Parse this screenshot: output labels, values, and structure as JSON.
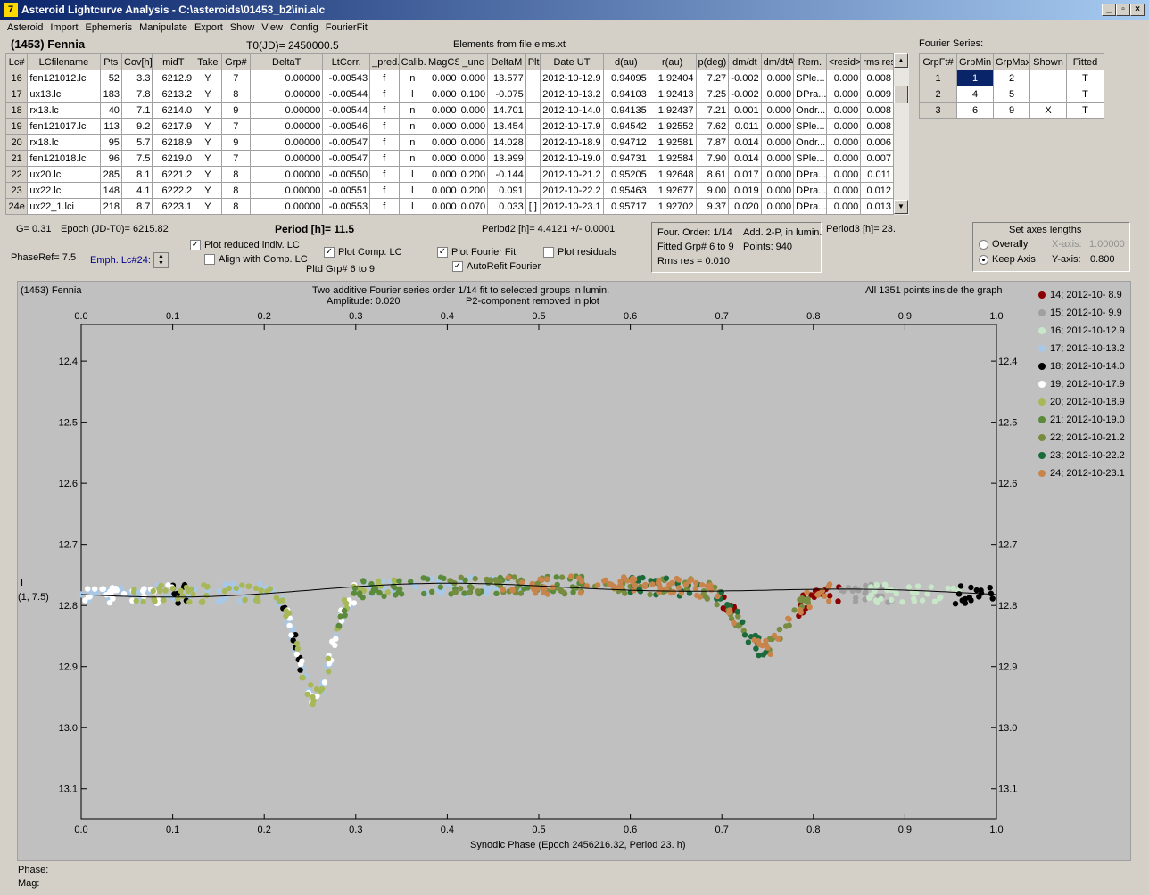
{
  "window": {
    "title": "Asteroid Lightcurve Analysis - C:\\asteroids\\01453_b2\\ini.alc",
    "icon_char": "7"
  },
  "menu": [
    "Asteroid",
    "Import",
    "Ephemeris",
    "Manipulate",
    "Export",
    "Show",
    "View",
    "Config",
    "FourierFit"
  ],
  "header": {
    "asteroid": "(1453) Fennia",
    "t0": "T0(JD)= 2450000.5",
    "elements": "Elements from file elms.xt"
  },
  "table": {
    "columns": [
      "Lc#",
      "LCfilename",
      "Pts",
      "Cov[h]",
      "midT",
      "Take",
      "Grp#",
      "DeltaT",
      "LtCorr.",
      "_pred.",
      "Calib.",
      "MagCS",
      "_unc",
      "DeltaM",
      "Plt",
      "Date UT",
      "d(au)",
      "r(au)",
      "p(deg)",
      "dm/dt",
      "dm/dtA",
      "Rem.",
      "<resid>",
      "rms res"
    ],
    "rows": [
      [
        "16",
        "fen121012.lc",
        "52",
        "3.3",
        "6212.9",
        "Y",
        "7",
        "0.00000",
        "-0.00543",
        "f",
        "n",
        "0.000",
        "0.000",
        "13.577",
        "",
        "2012-10-12.9",
        "0.94095",
        "1.92404",
        "7.27",
        "-0.002",
        "0.000",
        "SPle...",
        "0.000",
        "0.008"
      ],
      [
        "17",
        "ux13.lci",
        "183",
        "7.8",
        "6213.2",
        "Y",
        "8",
        "0.00000",
        "-0.00544",
        "f",
        "l",
        "0.000",
        "0.100",
        "-0.075",
        "",
        "2012-10-13.2",
        "0.94103",
        "1.92413",
        "7.25",
        "-0.002",
        "0.000",
        "DPra...",
        "0.000",
        "0.009"
      ],
      [
        "18",
        "rx13.lc",
        "40",
        "7.1",
        "6214.0",
        "Y",
        "9",
        "0.00000",
        "-0.00544",
        "f",
        "n",
        "0.000",
        "0.000",
        "14.701",
        "",
        "2012-10-14.0",
        "0.94135",
        "1.92437",
        "7.21",
        "0.001",
        "0.000",
        "Ondr...",
        "0.000",
        "0.008"
      ],
      [
        "19",
        "fen121017.lc",
        "113",
        "9.2",
        "6217.9",
        "Y",
        "7",
        "0.00000",
        "-0.00546",
        "f",
        "n",
        "0.000",
        "0.000",
        "13.454",
        "",
        "2012-10-17.9",
        "0.94542",
        "1.92552",
        "7.62",
        "0.011",
        "0.000",
        "SPle...",
        "0.000",
        "0.008"
      ],
      [
        "20",
        "rx18.lc",
        "95",
        "5.7",
        "6218.9",
        "Y",
        "9",
        "0.00000",
        "-0.00547",
        "f",
        "n",
        "0.000",
        "0.000",
        "14.028",
        "",
        "2012-10-18.9",
        "0.94712",
        "1.92581",
        "7.87",
        "0.014",
        "0.000",
        "Ondr...",
        "0.000",
        "0.006"
      ],
      [
        "21",
        "fen121018.lc",
        "96",
        "7.5",
        "6219.0",
        "Y",
        "7",
        "0.00000",
        "-0.00547",
        "f",
        "n",
        "0.000",
        "0.000",
        "13.999",
        "",
        "2012-10-19.0",
        "0.94731",
        "1.92584",
        "7.90",
        "0.014",
        "0.000",
        "SPle...",
        "0.000",
        "0.007"
      ],
      [
        "22",
        "ux20.lci",
        "285",
        "8.1",
        "6221.2",
        "Y",
        "8",
        "0.00000",
        "-0.00550",
        "f",
        "l",
        "0.000",
        "0.200",
        "-0.144",
        "",
        "2012-10-21.2",
        "0.95205",
        "1.92648",
        "8.61",
        "0.017",
        "0.000",
        "DPra...",
        "0.000",
        "0.011"
      ],
      [
        "23",
        "ux22.lci",
        "148",
        "4.1",
        "6222.2",
        "Y",
        "8",
        "0.00000",
        "-0.00551",
        "f",
        "l",
        "0.000",
        "0.200",
        "0.091",
        "",
        "2012-10-22.2",
        "0.95463",
        "1.92677",
        "9.00",
        "0.019",
        "0.000",
        "DPra...",
        "0.000",
        "0.012"
      ],
      [
        "24e",
        "ux22_1.lci",
        "218",
        "8.7",
        "6223.1",
        "Y",
        "8",
        "0.00000",
        "-0.00553",
        "f",
        "l",
        "0.000",
        "0.070",
        "0.033",
        "[ ]",
        "2012-10-23.1",
        "0.95717",
        "1.92702",
        "9.37",
        "0.020",
        "0.000",
        "DPra...",
        "0.000",
        "0.013"
      ]
    ]
  },
  "fourier": {
    "label": "Fourier Series:",
    "columns": [
      "GrpFt#",
      "GrpMin",
      "GrpMax",
      "Shown",
      "Fitted"
    ],
    "rows": [
      [
        "1",
        "1",
        "2",
        "",
        "T"
      ],
      [
        "2",
        "4",
        "5",
        "",
        "T"
      ],
      [
        "3",
        "6",
        "9",
        "X",
        "T"
      ]
    ]
  },
  "controls": {
    "g": "G= 0.31",
    "epoch": "Epoch (JD-T0)= 6215.82",
    "period": "Period [h]= 11.5",
    "period2": "Period2 [h]= 4.4121 +/- 0.0001",
    "phaseref": "PhaseRef= 7.5",
    "emph": "Emph. Lc#24:",
    "plot_reduced": "Plot reduced indiv. LC",
    "align": "Align with Comp. LC",
    "plot_comp": "Plot Comp. LC",
    "pltd_grp": "Pltd Grp#  6  to  9",
    "plot_fourier": "Plot Fourier Fit",
    "autorefit": "AutoRefit Fourier",
    "plot_resid": "Plot residuals",
    "info": {
      "order": "Four. Order:  1/14",
      "add": "Add. 2-P, in lumin.",
      "fitted": "Fitted Grp# 6 to 9",
      "points": "Points: 940",
      "rms": "Rms res    = 0.010"
    },
    "period3": "Period3 [h]= 23.",
    "axes": {
      "title": "Set axes lengths",
      "overally": "Overally",
      "keep": "Keep Axis",
      "xlabel": "X-axis:",
      "xval": "1.00000",
      "ylabel": "Y-axis:",
      "yval": "0.800"
    }
  },
  "plot": {
    "name": "(1453) Fennia",
    "line1": "Two additive Fourier series order 1/14 fit to selected groups in lumin.",
    "line2": "Amplitude: 0.020",
    "line3": "P2-component removed in plot",
    "points_info": "All 1351 points inside the graph",
    "ylab1": "I",
    "ylab2": "(1, 7.5)"
  },
  "status": {
    "phase": "Phase:",
    "mag": "Mag:"
  },
  "colors": {
    "accent": "#0a246a"
  },
  "chart_data": {
    "type": "scatter",
    "xlabel": "Synodic Phase (Epoch 2456216.32, Period 23. h)",
    "xlim": [
      0,
      1
    ],
    "ylim": [
      13.15,
      12.34
    ],
    "xticks": [
      "0.0",
      "0.1",
      "0.2",
      "0.3",
      "0.4",
      "0.5",
      "0.6",
      "0.7",
      "0.8",
      "0.9",
      "1.0"
    ],
    "yticks": [
      "12.4",
      "12.5",
      "12.6",
      "12.7",
      "12.8",
      "12.9",
      "13.0",
      "13.1"
    ],
    "series": [
      {
        "name": "14; 2012-10- 8.9",
        "color": "#8b0000",
        "x": [
          0.7,
          0.78
        ],
        "y": [
          12.83,
          12.82
        ],
        "segments": [
          [
            0.7,
            0.72
          ],
          [
            0.78,
            0.83
          ]
        ]
      },
      {
        "name": "15; 2012-10- 9.9",
        "color": "#a0a0a0",
        "x": [
          0.85,
          0.87
        ],
        "y": [
          12.78,
          12.78
        ],
        "segments": [
          [
            0.83,
            0.89
          ]
        ]
      },
      {
        "name": "16; 2012-10-12.9",
        "color": "#c8e6c8",
        "x": [
          0.87,
          0.95
        ],
        "y": [
          12.77,
          12.77
        ],
        "segments": [
          [
            0.86,
            0.97
          ]
        ]
      },
      {
        "name": "17; 2012-10-13.2",
        "color": "#a8c8e8",
        "x": [
          0.0,
          0.3
        ],
        "y": [
          12.78,
          12.78
        ],
        "segments": [
          [
            0.0,
            0.5
          ]
        ]
      },
      {
        "name": "18; 2012-10-14.0",
        "color": "#000000",
        "x": [
          0.96,
          1.0
        ],
        "y": [
          12.77,
          12.77
        ],
        "segments": [
          [
            0.955,
            1.0
          ],
          [
            0.1,
            0.12
          ],
          [
            0.22,
            0.24
          ]
        ]
      },
      {
        "name": "19; 2012-10-17.9",
        "color": "#ffffff",
        "x": [
          0.0,
          0.1
        ],
        "y": [
          12.78,
          12.78
        ],
        "segments": [
          [
            0.0,
            0.1
          ],
          [
            0.22,
            0.3
          ]
        ]
      },
      {
        "name": "20; 2012-10-18.9",
        "color": "#a8b858",
        "x": [
          0.05,
          0.3
        ],
        "y": [
          12.78,
          12.78
        ],
        "segments": [
          [
            0.05,
            0.35
          ]
        ]
      },
      {
        "name": "21; 2012-10-19.0",
        "color": "#5a8a3a",
        "x": [
          0.3,
          0.5
        ],
        "y": [
          12.77,
          12.77
        ],
        "segments": [
          [
            0.28,
            0.55
          ]
        ]
      },
      {
        "name": "22; 2012-10-21.2",
        "color": "#788c40",
        "x": [
          0.4,
          0.75
        ],
        "y": [
          12.77,
          12.77
        ],
        "segments": [
          [
            0.4,
            0.8
          ]
        ]
      },
      {
        "name": "23; 2012-10-22.2",
        "color": "#1a6a3a",
        "x": [
          0.6,
          0.75
        ],
        "y": [
          12.77,
          12.83
        ],
        "segments": [
          [
            0.6,
            0.75
          ]
        ]
      },
      {
        "name": "24; 2012-10-23.1",
        "color": "#c8844a",
        "x": [
          0.45,
          0.8
        ],
        "y": [
          12.77,
          12.85
        ],
        "segments": [
          [
            0.45,
            0.82
          ]
        ]
      }
    ],
    "fit": {
      "x": [
        0.0,
        0.1,
        0.2,
        0.3,
        0.4,
        0.5,
        0.6,
        0.7,
        0.8,
        0.9,
        1.0
      ],
      "y": [
        12.77,
        12.775,
        12.78,
        12.775,
        12.77,
        12.768,
        12.772,
        12.78,
        12.778,
        12.77,
        12.768
      ]
    }
  }
}
